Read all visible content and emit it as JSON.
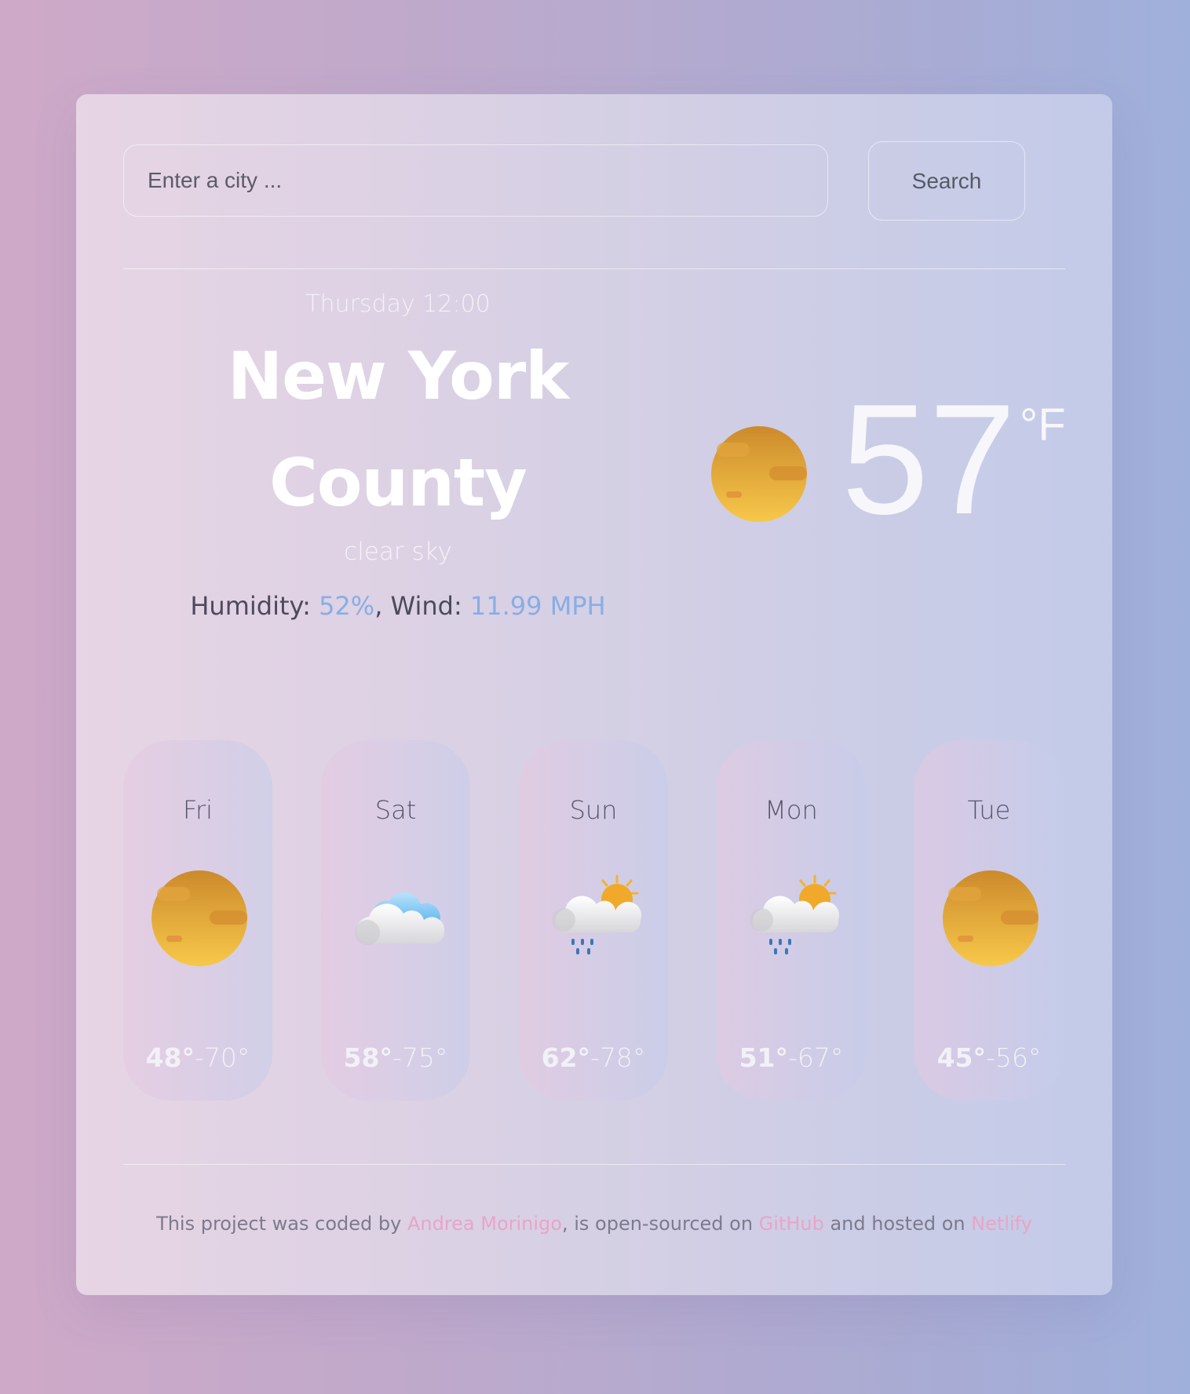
{
  "search": {
    "placeholder": "Enter a city ...",
    "button_label": "Search"
  },
  "current": {
    "daytime": "Thursday 12:00",
    "city_line1": "New York",
    "city_line2": "County",
    "description": "clear sky",
    "humidity_label": "Humidity: ",
    "humidity_value": "52%",
    "wind_label": ", Wind: ",
    "wind_value": "11.99 MPH",
    "temperature": "57",
    "unit": "°F",
    "icon": "sun-icon"
  },
  "forecast": [
    {
      "day": "Fri",
      "max": "48°",
      "min": "-70°",
      "icon": "sun-icon"
    },
    {
      "day": "Sat",
      "max": "58°",
      "min": "-75°",
      "icon": "cloud-icon"
    },
    {
      "day": "Sun",
      "max": "62°",
      "min": "-78°",
      "icon": "rain-sun-cloud-icon"
    },
    {
      "day": "Mon",
      "max": "51°",
      "min": "-67°",
      "icon": "rain-sun-cloud-icon"
    },
    {
      "day": "Tue",
      "max": "45°",
      "min": "-56°",
      "icon": "sun-icon"
    }
  ],
  "footer": {
    "text1": "This project was coded by ",
    "author": "Andrea Morinigo",
    "text2": ", is open-sourced on ",
    "github": "GitHub",
    "text3": " and hosted on ",
    "netlify": "Netlify"
  },
  "colors": {
    "accent_blue": "#86aee6",
    "link_pink": "#e8a5c8",
    "sun_top": "#d08b2a",
    "sun_bottom": "#f6c646"
  }
}
